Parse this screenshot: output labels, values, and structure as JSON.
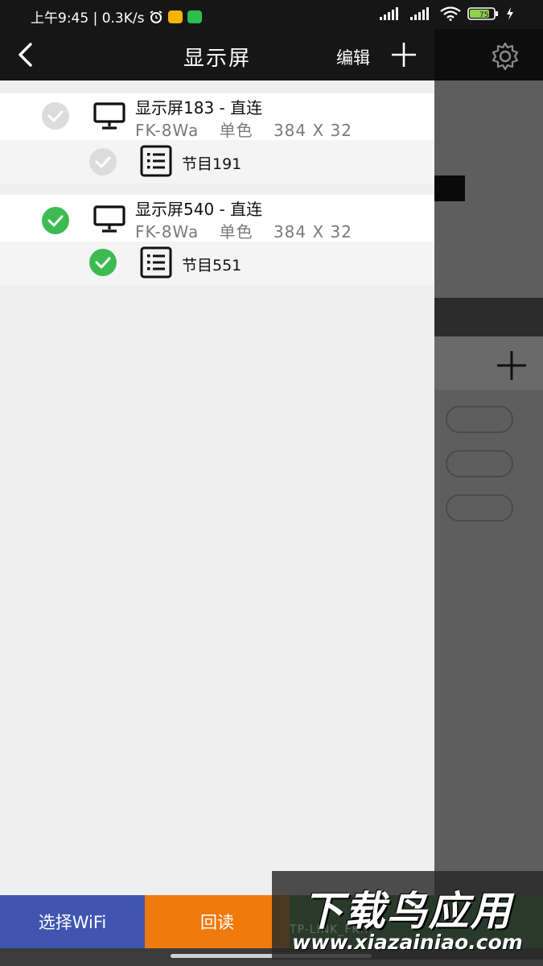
{
  "status_bar": {
    "time_net": "上午9:45 | 0.3K/s",
    "battery_level": "75"
  },
  "header": {
    "title": "显示屏",
    "edit_label": "编辑"
  },
  "devices": [
    {
      "name": "显示屏183 - 直连",
      "model": "FK-8Wa",
      "color_mode": "单色",
      "resolution": "384 X 32",
      "checked": false,
      "program": {
        "name": "节目191",
        "checked": false
      }
    },
    {
      "name": "显示屏540 - 直连",
      "model": "FK-8Wa",
      "color_mode": "单色",
      "resolution": "384 X 32",
      "checked": true,
      "program": {
        "name": "节目551",
        "checked": true
      }
    }
  ],
  "bottom": {
    "wifi_label": "选择WiFi",
    "readback_label": "回读",
    "third_label_faded": "TP-LINK_FK..."
  },
  "watermark": {
    "title": "下载鸟应用",
    "url": "www.xiazainiao.com"
  },
  "colors": {
    "check_active": "#3dbb53",
    "check_inactive": "#dcdcdc",
    "wifi_button": "#3f55b0",
    "readback_button": "#f07a0c"
  }
}
